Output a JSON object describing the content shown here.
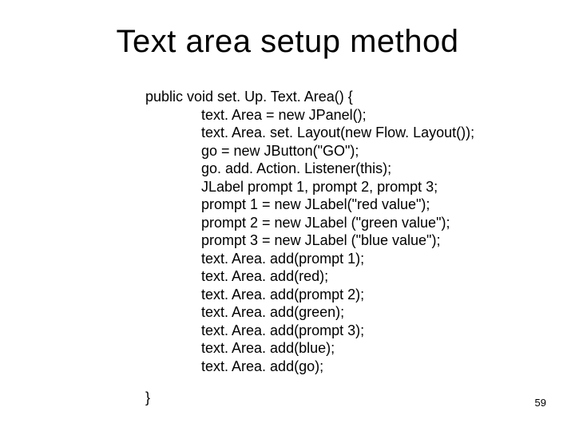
{
  "title": "Text area setup method",
  "code": {
    "signature": "public void set. Up. Text. Area() {",
    "lines": [
      "text. Area = new JPanel();",
      "text. Area. set. Layout(new Flow. Layout());",
      "go = new JButton(\"GO\");",
      "go. add. Action. Listener(this);",
      "JLabel prompt 1, prompt 2, prompt 3;",
      "prompt 1 = new JLabel(\"red value\");",
      "prompt 2 = new JLabel (\"green value\");",
      "prompt 3 = new JLabel (\"blue value\");",
      "text. Area. add(prompt 1);",
      "text. Area. add(red);",
      "text. Area. add(prompt 2);",
      "text. Area. add(green);",
      "text. Area. add(prompt 3);",
      "text. Area. add(blue);",
      "text. Area. add(go);"
    ],
    "close": "}"
  },
  "page_number": "59"
}
